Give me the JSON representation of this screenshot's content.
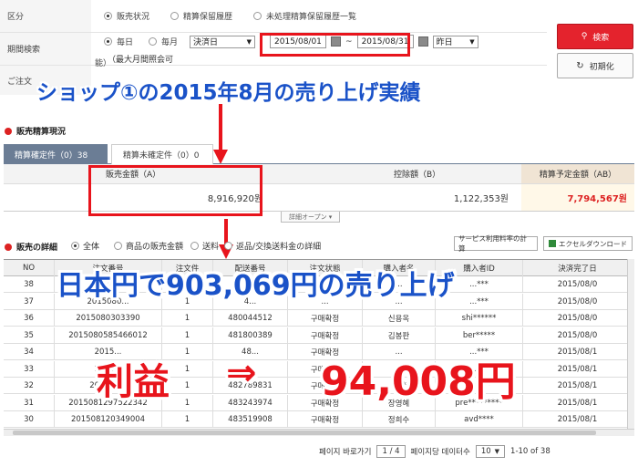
{
  "search": {
    "row1_label": "区分",
    "row1_options": [
      "販売状況",
      "精算保留履歴",
      "未処理精算保留履歴一覧"
    ],
    "row2_label": "期間検索",
    "period_options": [
      "毎日",
      "毎月"
    ],
    "settle_select": "決済日",
    "date_from": "2015/08/01",
    "date_sep": "~",
    "date_to": "2015/08/31",
    "preset_select": "昨日",
    "note": "（最大月間照会可",
    "note_cont": "能）",
    "row3_label": "ご注文",
    "search_button": "検索",
    "reset_button": "初期化"
  },
  "annotations": {
    "shop_caption": "ショップ①の2015年8月の売り上げ実績",
    "yen_caption": "日本円で903,069円の売り上げ",
    "profit_label": "利益",
    "profit_arrow": "⇒",
    "profit_value": "94,008円"
  },
  "summary": {
    "section_title": "販売精算現況",
    "tab_settled": "精算確定件（0）38",
    "tab_unsettled": "精算未確定件（0）0",
    "col_sales": "販売金額（A）",
    "col_deduct": "控除額（B）",
    "col_expected": "精算予定金額（AB）",
    "sales_value": "8,916,920원",
    "deduct_value": "1,122,353원",
    "expected_value": "7,794,567원",
    "expand_label": "詳細オープン ▾"
  },
  "detail": {
    "section_title": "販売の詳細",
    "filter_options": [
      "全体",
      "商品の販売金額",
      "送料",
      "返品/交換送料金の詳細"
    ],
    "btn_fee": "サービス利用料率の計算",
    "btn_excel": "エクセルダウンロード",
    "columns": [
      "NO",
      "注文番号",
      "注文件",
      "配送番号",
      "注文状態",
      "購入者名",
      "購入者ID",
      "決済完了日"
    ],
    "rows": [
      [
        "38",
        "2015080...",
        "1",
        "4...",
        "...",
        "...",
        "...***",
        "2015/08/0"
      ],
      [
        "37",
        "2015080...",
        "1",
        "4...",
        "...",
        "...",
        "...***",
        "2015/08/0"
      ],
      [
        "36",
        "2015080303390",
        "1",
        "480044512",
        "구매확정",
        "신용옥",
        "shi******",
        "2015/08/0"
      ],
      [
        "35",
        "2015080585466012",
        "1",
        "481800389",
        "구매확정",
        "김봉판",
        "ber*****",
        "2015/08/0"
      ],
      [
        "34",
        "2015...",
        "1",
        "48...",
        "구매확정",
        "...",
        "...***",
        "2015/08/1"
      ],
      [
        "33",
        "2015...",
        "1",
        "...",
        "구매확정",
        "...",
        "...***",
        "2015/08/1"
      ],
      [
        "32",
        "201508...",
        "1",
        "482789831",
        "구매확정",
        "...**",
        "ev****",
        "2015/08/1"
      ],
      [
        "31",
        "2015081297522342",
        "1",
        "483243974",
        "구매확정",
        "장영혜",
        "pre*********",
        "2015/08/1"
      ],
      [
        "30",
        "201508120349004",
        "1",
        "483519908",
        "구매확정",
        "정희수",
        "avd****",
        "2015/08/1"
      ]
    ]
  },
  "pager": {
    "goto_label": "페이지 바로가기",
    "page": "1 / 4",
    "per_page_label": "페이지당 데이터수",
    "per_page": "10",
    "range": "1-10 of 38"
  }
}
